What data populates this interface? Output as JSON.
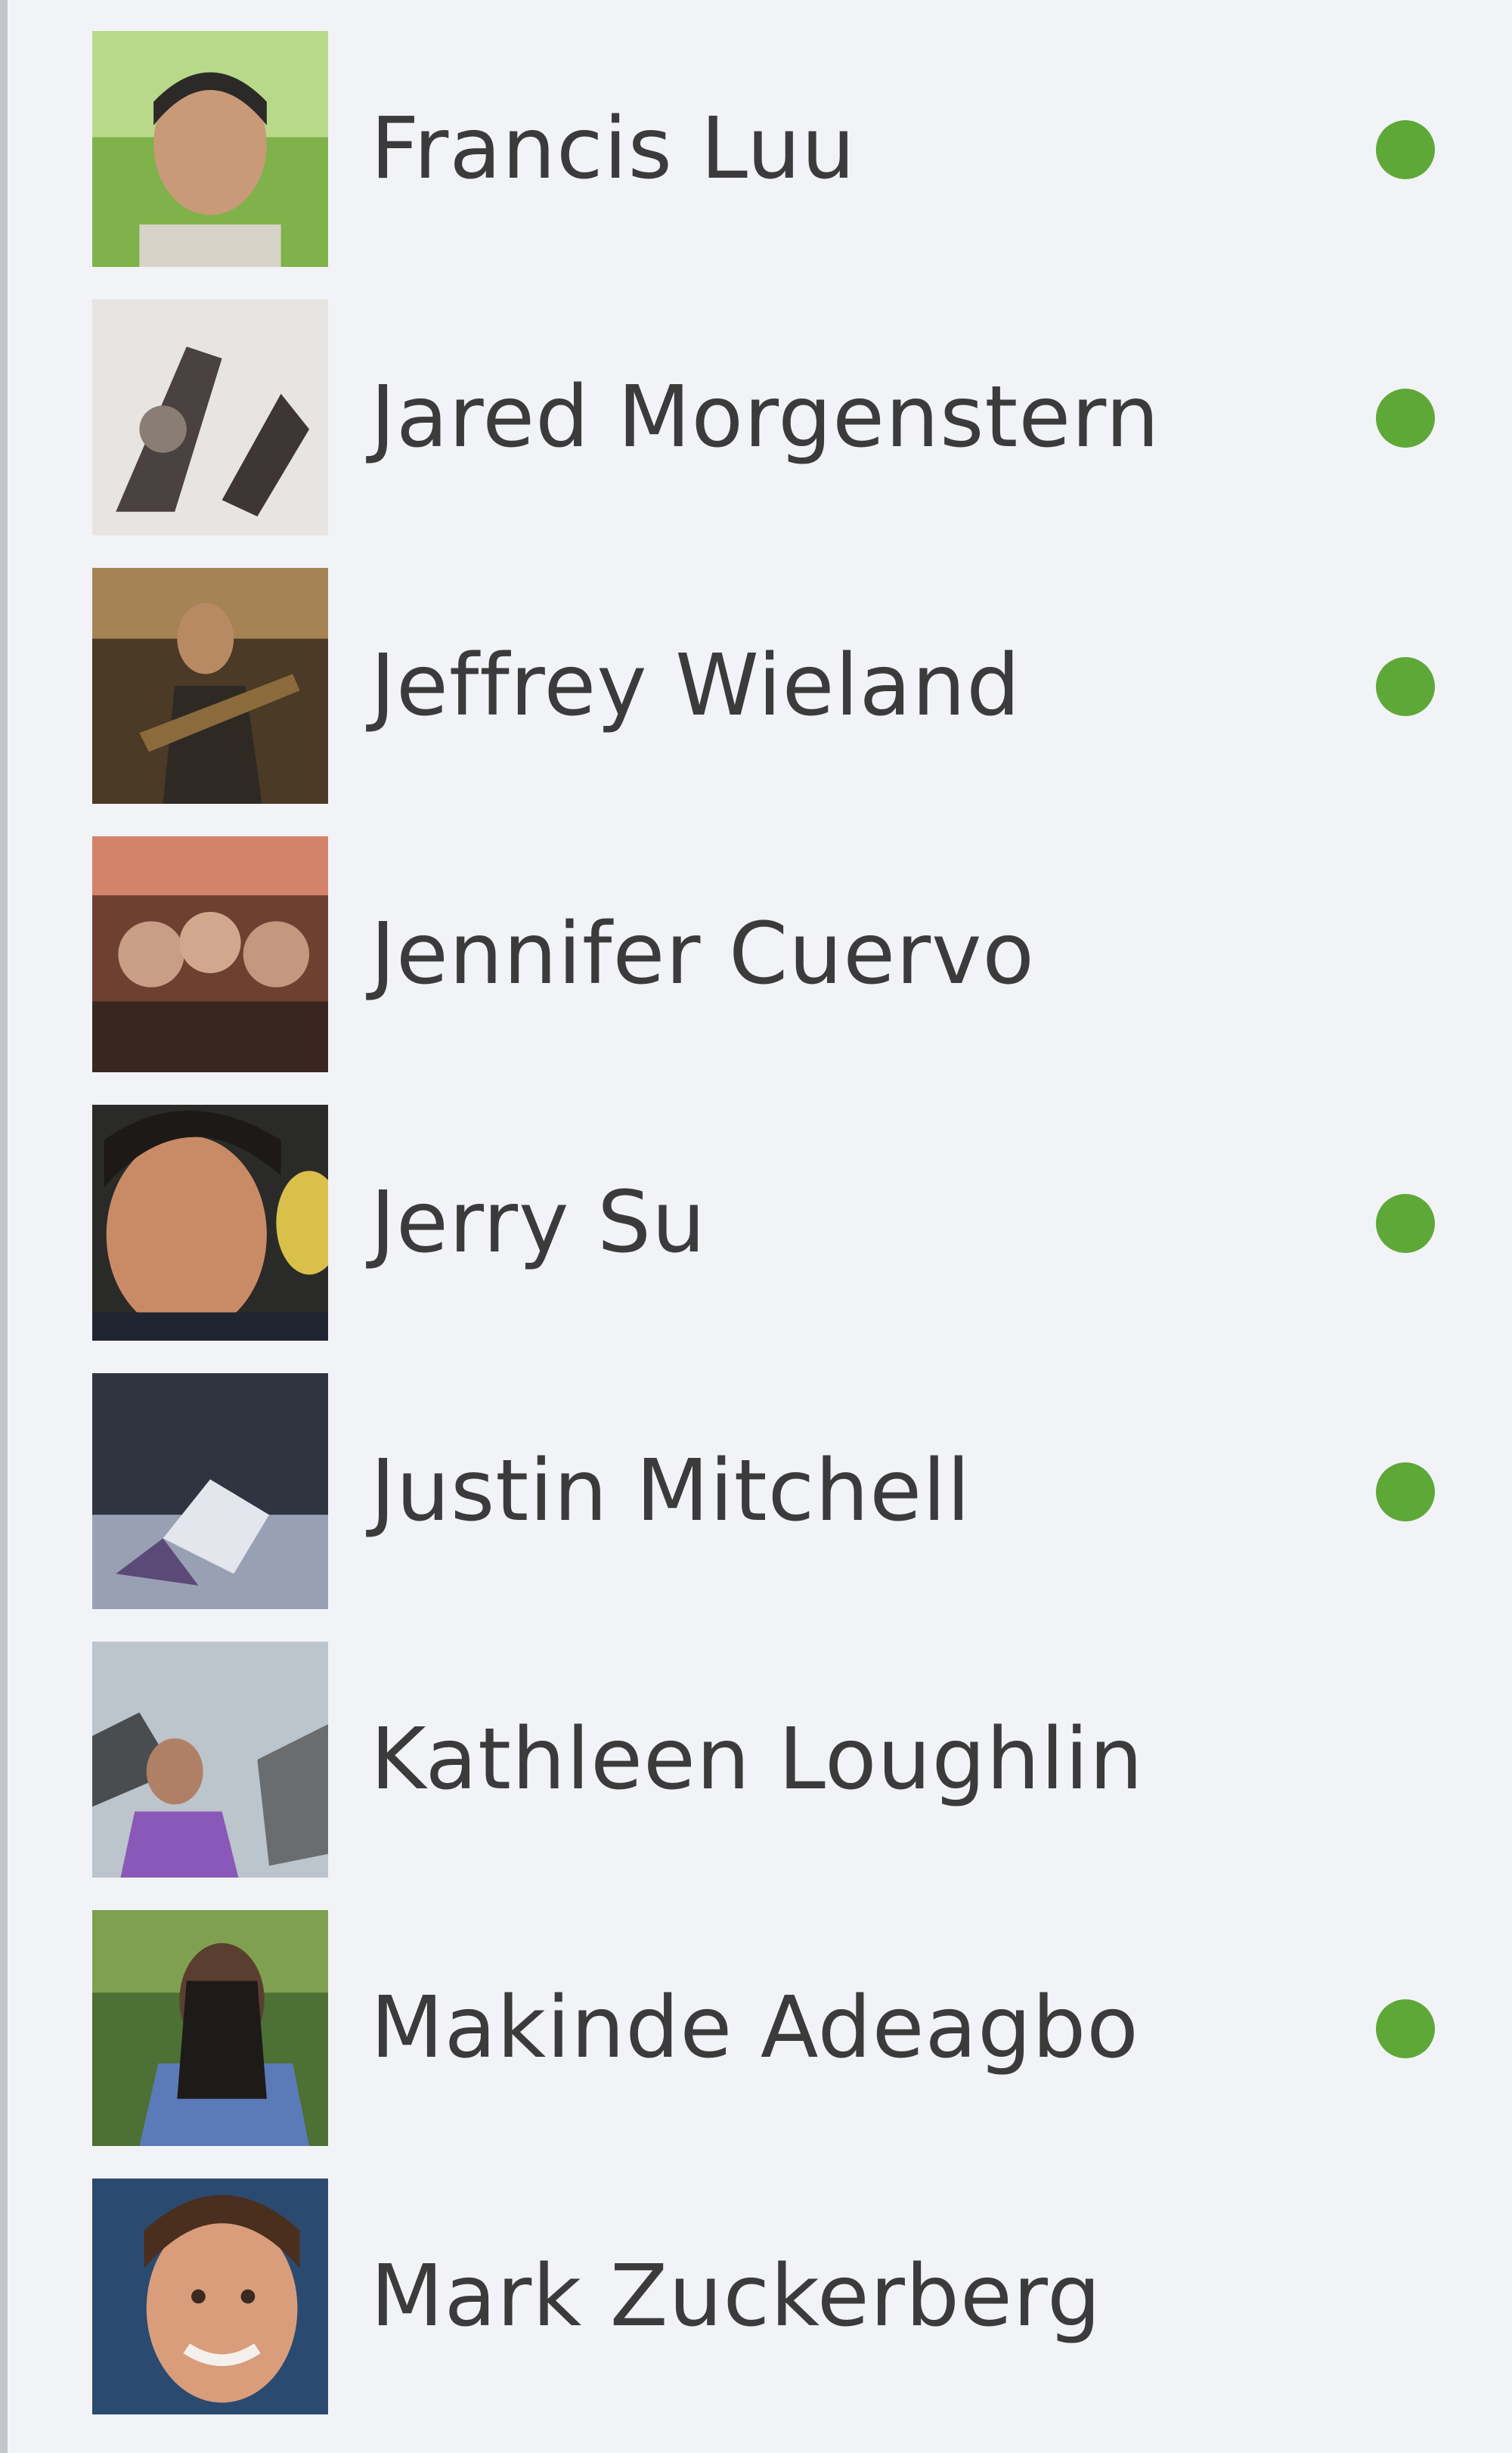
{
  "friends": [
    {
      "name": "Francis Luu",
      "online": true
    },
    {
      "name": "Jared Morgenstern",
      "online": true
    },
    {
      "name": "Jeffrey Wieland",
      "online": true
    },
    {
      "name": "Jennifer Cuervo",
      "online": false
    },
    {
      "name": "Jerry Su",
      "online": true
    },
    {
      "name": "Justin Mitchell",
      "online": true
    },
    {
      "name": "Kathleen Loughlin",
      "online": false
    },
    {
      "name": "Makinde Adeagbo",
      "online": true
    },
    {
      "name": "Mark Zuckerberg",
      "online": false
    }
  ],
  "colors": {
    "background": "#f2f3f7",
    "online_dot": "#5ea838",
    "name_text": "#3b3b3b"
  }
}
